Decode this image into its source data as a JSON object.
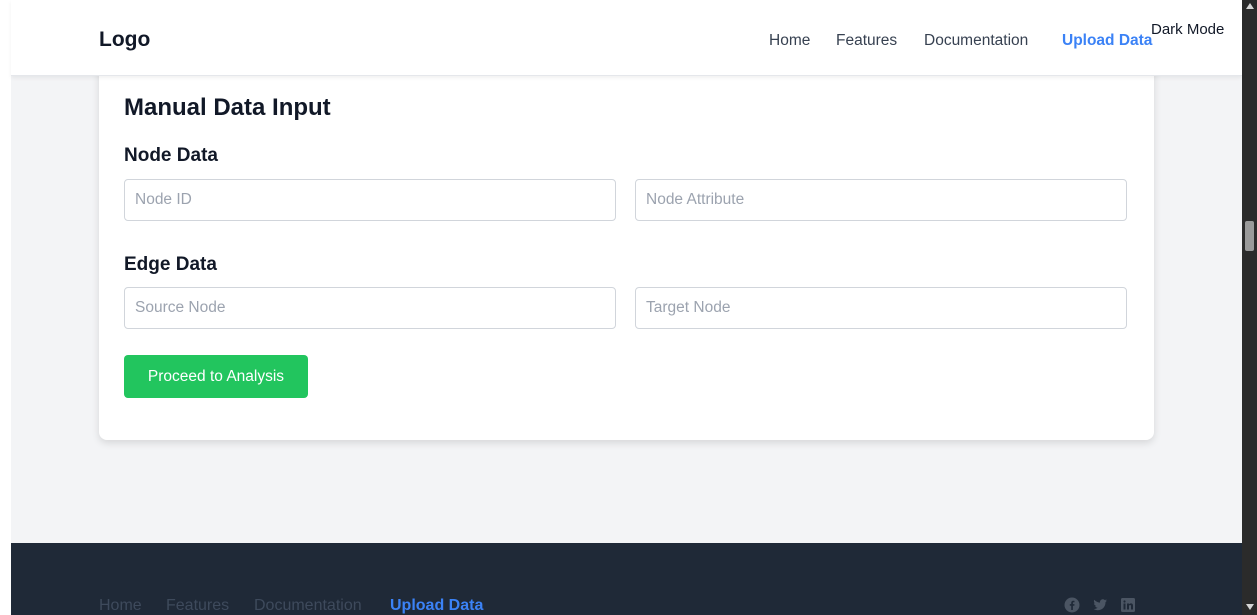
{
  "header": {
    "logo": "Logo",
    "nav": [
      {
        "label": "Home"
      },
      {
        "label": "Features"
      },
      {
        "label": "Documentation"
      },
      {
        "label": "Upload Data"
      }
    ],
    "dark_mode": "Dark Mode"
  },
  "card": {
    "title": "Manual Data Input",
    "node_section": {
      "title": "Node Data",
      "node_id_placeholder": "Node ID",
      "node_attribute_placeholder": "Node Attribute"
    },
    "edge_section": {
      "title": "Edge Data",
      "source_placeholder": "Source Node",
      "target_placeholder": "Target Node"
    },
    "proceed_button": "Proceed to Analysis"
  },
  "footer": {
    "nav": [
      {
        "label": "Home"
      },
      {
        "label": "Features"
      },
      {
        "label": "Documentation"
      },
      {
        "label": "Upload Data"
      }
    ],
    "social": [
      "facebook-icon",
      "twitter-icon",
      "linkedin-icon"
    ]
  },
  "colors": {
    "accent": "#3b82f6",
    "success": "#22c55e",
    "footer_bg": "#1f2937"
  }
}
